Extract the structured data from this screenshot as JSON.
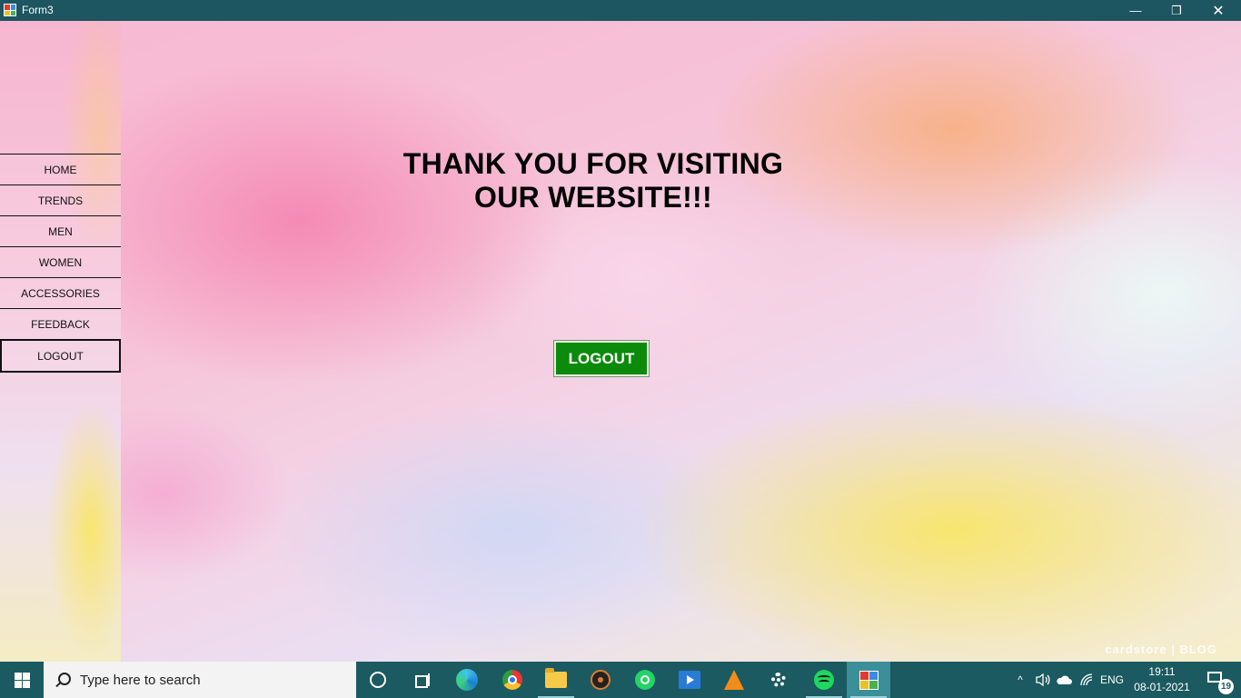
{
  "window": {
    "title": "Form3",
    "minimize": "—",
    "maximize": "❐",
    "close": "✕"
  },
  "sidebar": {
    "items": [
      {
        "label": "HOME"
      },
      {
        "label": "TRENDS"
      },
      {
        "label": "MEN"
      },
      {
        "label": "WOMEN"
      },
      {
        "label": "ACCESSORIES"
      },
      {
        "label": "FEEDBACK"
      },
      {
        "label": "LOGOUT"
      }
    ]
  },
  "main": {
    "headline_line1": "THANK YOU FOR VISITING",
    "headline_line2": "OUR WEBSITE!!!",
    "logout_button": "LOGOUT",
    "watermark": "cardstore | BLOG"
  },
  "taskbar": {
    "search_placeholder": "Type here to search",
    "tray": {
      "chevron": "^",
      "language": "ENG",
      "time": "19:11",
      "date": "08-01-2021",
      "notification_count": "19"
    }
  },
  "colors": {
    "titlebar": "#1d5560",
    "taskbar": "#1b5a60",
    "logout_green": "#0b8a0b"
  }
}
